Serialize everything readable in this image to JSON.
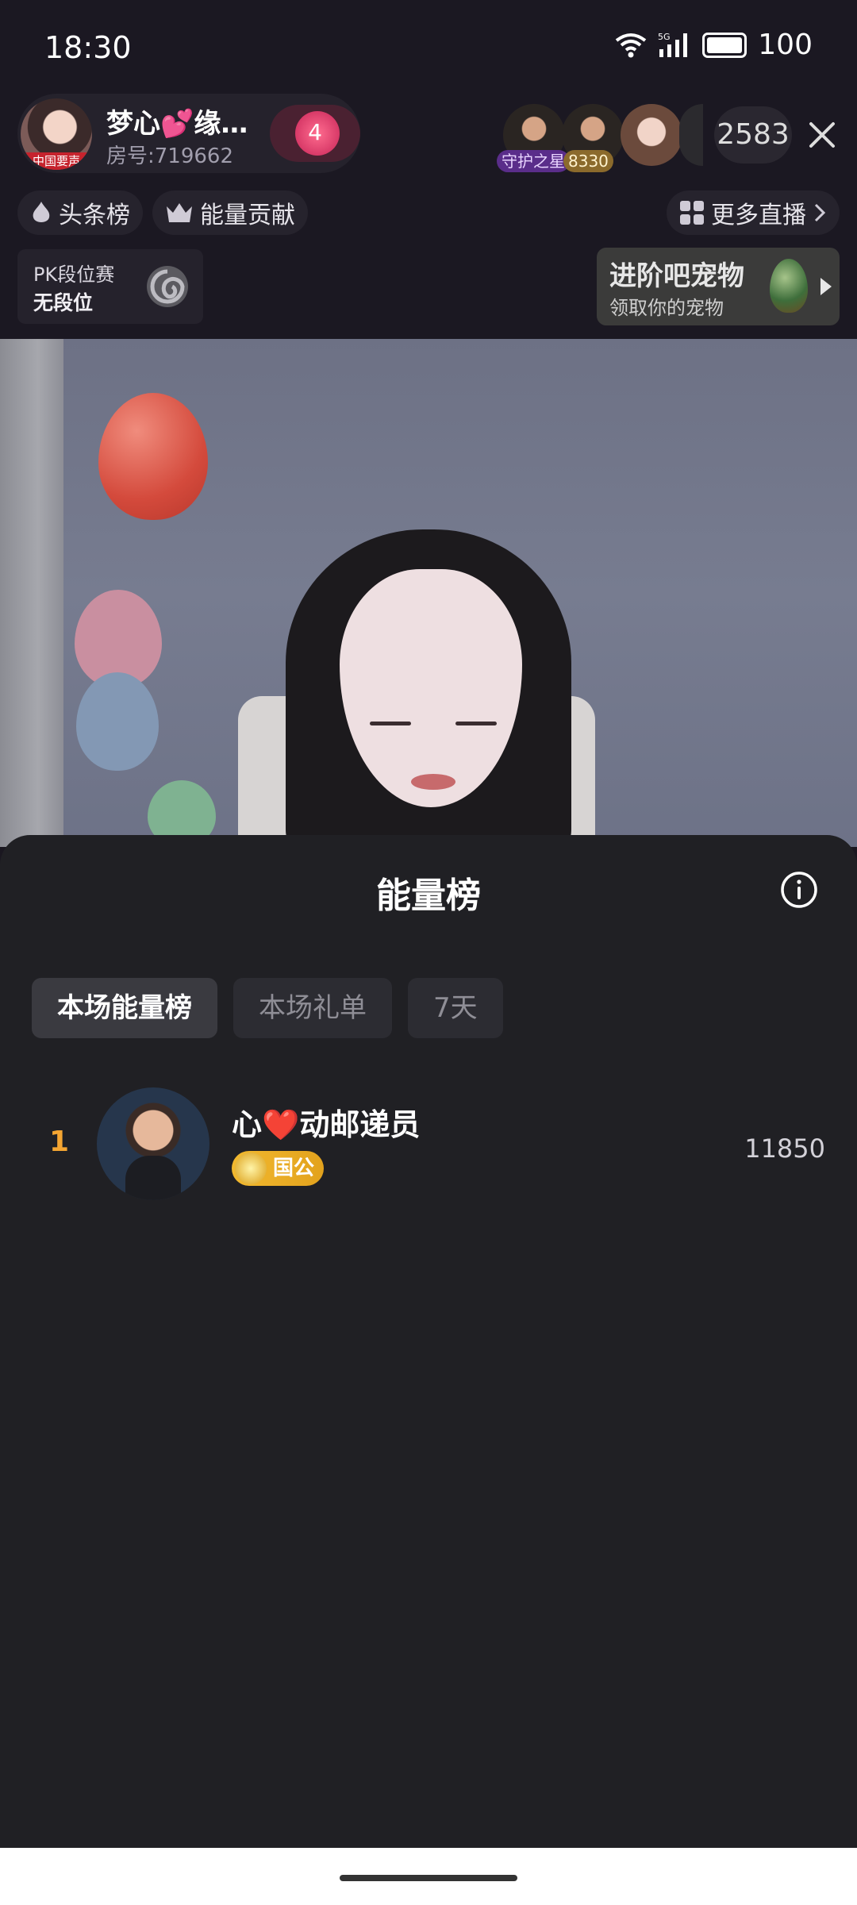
{
  "status_bar": {
    "time": "18:30",
    "network": "5G",
    "battery": "100"
  },
  "host": {
    "name": "梦心💕缘…",
    "room": "房号:719662",
    "avatar_tag": "中国要声",
    "heart_count": "4"
  },
  "viewers": {
    "badges": [
      "守护之星",
      "8330"
    ],
    "count": "2583"
  },
  "links": {
    "headline_rank": "头条榜",
    "energy_contribution": "能量贡献",
    "more_live": "更多直播"
  },
  "pk": {
    "label": "PK段位赛",
    "rank": "无段位"
  },
  "pet": {
    "title": "进阶吧宠物",
    "subtitle": "领取你的宠物"
  },
  "sheet": {
    "title": "能量榜",
    "tabs": [
      "本场能量榜",
      "本场礼单",
      "7天"
    ],
    "active_tab": "本场能量榜",
    "entries": [
      {
        "rank": "1",
        "name": "心❤️动邮递员",
        "badge": "国公",
        "score": "11850"
      }
    ]
  },
  "colors": {
    "rank_accent": "#f4a532",
    "badge_gold": "#f2b92f",
    "sheet_bg": "#202024"
  }
}
